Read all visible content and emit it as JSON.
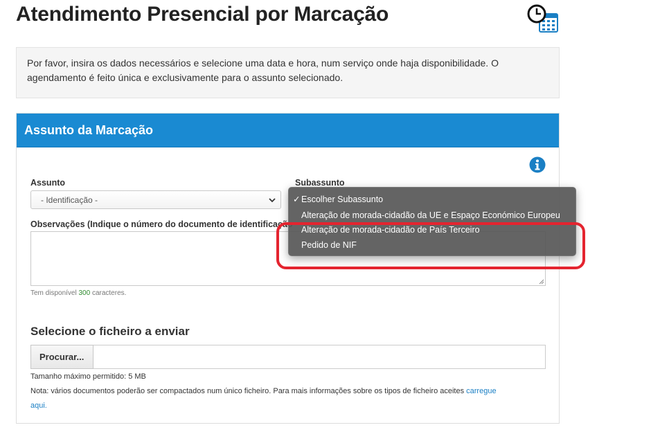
{
  "page": {
    "title": "Atendimento Presencial por Marcação",
    "intro": "Por favor, insira os dados necessários e selecione uma data e hora, num serviço onde haja disponibilidade. O agendamento é feito única e exclusivamente para o assunto selecionado."
  },
  "panel": {
    "title": "Assunto da Marcação",
    "assunto_label": "Assunto",
    "assunto_value": "- Identificação -",
    "subassunto_label": "Subassunto",
    "observacoes_label": "Observações (Indique o número do documento de identificação",
    "char_prefix": "Tem disponível ",
    "char_count": "300",
    "char_suffix": " caracteres."
  },
  "file": {
    "heading": "Selecione o ficheiro a enviar",
    "browse_label": "Procurar...",
    "max_size": "Tamanho máximo permitido: 5 MB",
    "note": "Nota: vários documentos poderão ser compactados num único ficheiro. Para mais informações sobre os tipos de ficheiro aceites ",
    "link_text_1": "carregue",
    "link_text_2": "aqui."
  },
  "dropdown": {
    "items": [
      {
        "label": "Escolher Subassunto",
        "checked": true
      },
      {
        "label": "Alteração de morada-cidadão da UE e Espaço Económico Europeu",
        "checked": false
      },
      {
        "label": "Alteração de morada-cidadão de País Terceiro",
        "checked": false
      },
      {
        "label": "Pedido de NIF",
        "checked": false
      }
    ]
  },
  "icons": {
    "calendar": "calendar-clock-icon",
    "info": "info-icon",
    "chevron": "chevron-down-icon"
  },
  "colors": {
    "header_blue": "#1a8ad2",
    "highlight_red": "#e4242f",
    "link": "#1a7fc4",
    "count_green": "#2e8b2e"
  }
}
